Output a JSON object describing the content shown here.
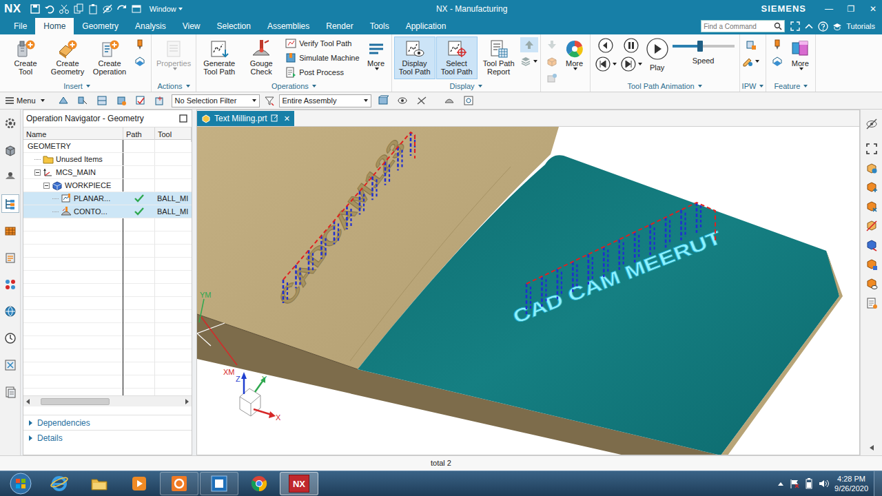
{
  "window": {
    "logo": "NX",
    "title": "NX - Manufacturing",
    "brand": "SIEMENS",
    "window_menu": "Window",
    "controls": [
      "—",
      "❐",
      "✕"
    ]
  },
  "ribbon_tabs": [
    {
      "label": "File",
      "selected": false
    },
    {
      "label": "Home",
      "selected": true
    },
    {
      "label": "Geometry",
      "selected": false
    },
    {
      "label": "Analysis",
      "selected": false
    },
    {
      "label": "View",
      "selected": false
    },
    {
      "label": "Selection",
      "selected": false
    },
    {
      "label": "Assemblies",
      "selected": false
    },
    {
      "label": "Render",
      "selected": false
    },
    {
      "label": "Tools",
      "selected": false
    },
    {
      "label": "Application",
      "selected": false
    }
  ],
  "search": {
    "placeholder": "Find a Command"
  },
  "help_link": "Tutorials",
  "ribbon_groups": [
    {
      "label": "Insert",
      "menu": true,
      "items": [
        {
          "kind": "large",
          "label": "Create Tool",
          "selected": false,
          "disabled": false,
          "dropdown": false
        },
        {
          "kind": "large",
          "label": "Create Geometry",
          "selected": false,
          "disabled": false,
          "dropdown": false
        },
        {
          "kind": "large",
          "label": "Create Operation",
          "selected": false,
          "disabled": false,
          "dropdown": false
        },
        {
          "kind": "icons",
          "icons": [
            {
              "selected": false,
              "disabled": false,
              "dropdown": false
            },
            {
              "selected": false,
              "disabled": false,
              "dropdown": false
            }
          ]
        }
      ]
    },
    {
      "label": "Actions",
      "menu": true,
      "items": [
        {
          "kind": "large",
          "label": "Properties",
          "selected": false,
          "disabled": true,
          "dropdown": true
        }
      ]
    },
    {
      "label": "Operations",
      "menu": true,
      "items": [
        {
          "kind": "large",
          "label": "Generate Tool Path",
          "selected": false,
          "disabled": false,
          "dropdown": false
        },
        {
          "kind": "large",
          "label": "Gouge Check",
          "selected": false,
          "disabled": false,
          "dropdown": false
        },
        {
          "kind": "small",
          "entries": [
            {
              "label": "Verify Tool Path",
              "disabled": false
            },
            {
              "label": "Simulate Machine",
              "disabled": false
            },
            {
              "label": "Post Process",
              "disabled": false
            }
          ]
        },
        {
          "kind": "large",
          "label": "More",
          "selected": false,
          "disabled": false,
          "dropdown": true
        }
      ]
    },
    {
      "label": "Display",
      "menu": true,
      "items": [
        {
          "kind": "large",
          "label": "Display Tool Path",
          "selected": true,
          "disabled": false,
          "dropdown": false
        },
        {
          "kind": "large",
          "label": "Select Tool Path",
          "selected": true,
          "disabled": false,
          "dropdown": false
        },
        {
          "kind": "large",
          "label": "Tool Path Report",
          "selected": false,
          "disabled": false,
          "dropdown": false
        },
        {
          "kind": "icons",
          "icons": [
            {
              "selected": true,
              "disabled": false,
              "dropdown": false
            },
            {
              "selected": false,
              "disabled": false,
              "dropdown": true
            }
          ]
        }
      ]
    },
    {
      "menu": false,
      "items": [
        {
          "kind": "icons",
          "icons": [
            {
              "selected": false,
              "disabled": true,
              "dropdown": false
            },
            {
              "selected": false,
              "disabled": true,
              "dropdown": false
            },
            {
              "selected": false,
              "disabled": true,
              "dropdown": false
            }
          ]
        },
        {
          "kind": "large",
          "label": "More",
          "selected": false,
          "disabled": false,
          "dropdown": true
        }
      ]
    },
    {
      "label": "Tool Path Animation",
      "menu": true,
      "items": [
        {
          "kind": "animation",
          "play_label": "Play",
          "speed_label": "Speed",
          "speed_level": 0.45
        }
      ]
    },
    {
      "label": "IPW",
      "menu": true,
      "items": [
        {
          "kind": "icons",
          "icons": [
            {
              "selected": false,
              "disabled": false,
              "dropdown": false
            },
            {
              "selected": false,
              "disabled": false,
              "dropdown": true
            }
          ]
        }
      ]
    },
    {
      "label": "Feature",
      "menu": true,
      "items": [
        {
          "kind": "icons",
          "icons": [
            {
              "selected": false,
              "disabled": false,
              "dropdown": false
            },
            {
              "selected": false,
              "disabled": false,
              "dropdown": false
            }
          ]
        },
        {
          "kind": "large",
          "label": "More",
          "selected": false,
          "disabled": false,
          "dropdown": true
        }
      ]
    }
  ],
  "toolbar": {
    "menu": "Menu",
    "filters": [
      {
        "value": "No Selection Filter"
      },
      {
        "value": "Entire Assembly"
      }
    ]
  },
  "left_strip": [
    {
      "selected": false
    },
    {
      "selected": false
    },
    {
      "selected": false
    },
    {
      "selected": true
    },
    {
      "selected": false
    },
    {
      "selected": false
    },
    {
      "selected": false
    },
    {
      "selected": false
    },
    {
      "selected": false
    },
    {
      "selected": false
    },
    {
      "selected": false
    }
  ],
  "navigator": {
    "title": "Operation Navigator - Geometry",
    "columns": [
      "Name",
      "Path",
      "Tool"
    ],
    "rows": [
      {
        "name": "GEOMETRY",
        "depth": 0,
        "kind": "root",
        "selected": false,
        "path_ok": false,
        "tool": ""
      },
      {
        "name": "Unused Items",
        "depth": 1,
        "kind": "folder",
        "selected": false,
        "path_ok": false,
        "tool": ""
      },
      {
        "name": "MCS_MAIN",
        "depth": 1,
        "kind": "mcs",
        "expanded": true,
        "selected": false,
        "path_ok": false,
        "tool": ""
      },
      {
        "name": "WORKPIECE",
        "depth": 2,
        "kind": "workpiece",
        "expanded": true,
        "selected": false,
        "path_ok": false,
        "tool": ""
      },
      {
        "name": "PLANAR...",
        "depth": 3,
        "kind": "planar",
        "selected": true,
        "path_ok": true,
        "tool": "BALL_MI"
      },
      {
        "name": "CONTO...",
        "depth": 3,
        "kind": "contour",
        "selected": true,
        "path_ok": true,
        "tool": "BALL_MI"
      }
    ],
    "sections": [
      {
        "label": "Dependencies",
        "expanded": false
      },
      {
        "label": "Details",
        "expanded": false
      }
    ]
  },
  "graphics": {
    "tab": {
      "label": "Text Milling.prt",
      "selected": true,
      "close": "✕"
    },
    "model_texts": [
      "CAD CAM MEERUT",
      "CADCAM123"
    ],
    "axes": {
      "ym": "YM",
      "xm": "XM",
      "z": "Z",
      "y": "Y",
      "x": "X"
    }
  },
  "status_bar": {
    "text": "total 2"
  },
  "taskbar": {
    "apps": [
      {
        "running": false,
        "selected": false
      },
      {
        "running": false,
        "selected": false
      },
      {
        "running": false,
        "selected": false
      },
      {
        "running": true,
        "selected": false
      },
      {
        "running": true,
        "selected": false
      },
      {
        "running": false,
        "selected": false
      },
      {
        "running": true,
        "selected": true,
        "label": "NX"
      }
    ],
    "clock": {
      "time": "4:28 PM",
      "date": "9/26/2020"
    }
  }
}
